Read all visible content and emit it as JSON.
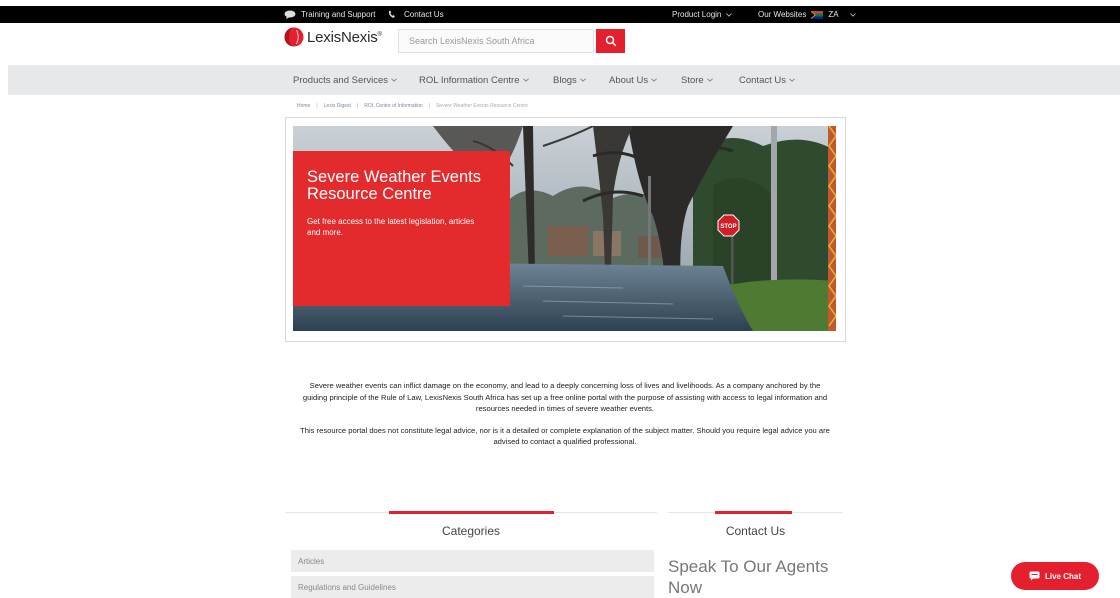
{
  "topbar": {
    "training": "Training and Support",
    "contact": "Contact Us",
    "product_login": "Product Login",
    "our_websites": "Our Websites",
    "country": "ZA"
  },
  "header": {
    "logo_text": "LexisNexis",
    "logo_reg": "®",
    "search_placeholder": "Search LexisNexis South Africa"
  },
  "nav": {
    "items": [
      {
        "label": "Products and Services"
      },
      {
        "label": "ROL Information Centre"
      },
      {
        "label": "Blogs"
      },
      {
        "label": "About Us"
      },
      {
        "label": "Store"
      },
      {
        "label": "Contact Us"
      }
    ]
  },
  "breadcrumb": [
    "Home",
    "Lexis Digest",
    "ROL Centre of Information",
    "Severe Weather Events Resource Centre"
  ],
  "hero": {
    "title": "Severe Weather Events Resource Centre",
    "subtitle": "Get free access to the latest legislation, articles and more.",
    "sign_text": "STOP"
  },
  "intro": {
    "p1": "Severe weather events can inflict damage on the economy, and lead to a deeply concerning loss of lives and livelihoods. As a company anchored by the guiding principle of the Rule of Law, LexisNexis South Africa has set up a free online portal with the purpose of assisting with access to legal information and resources needed in times of severe weather events.",
    "p2": "This resource portal does not constitute legal advice, nor is it a detailed or complete explanation of the subject matter. Should you require legal advice you are advised to contact a qualified professional."
  },
  "categories": {
    "title": "Categories",
    "items": [
      {
        "label": "Articles"
      },
      {
        "label": "Regulations and Guidelines"
      }
    ]
  },
  "contact": {
    "title": "Contact Us",
    "heading": "Speak To Our Agents Now"
  },
  "live_chat": {
    "label": "Live Chat"
  },
  "colors": {
    "brand_red": "#e5202e",
    "nav_bg": "#e7e8ea",
    "topbar_bg": "#000000"
  }
}
